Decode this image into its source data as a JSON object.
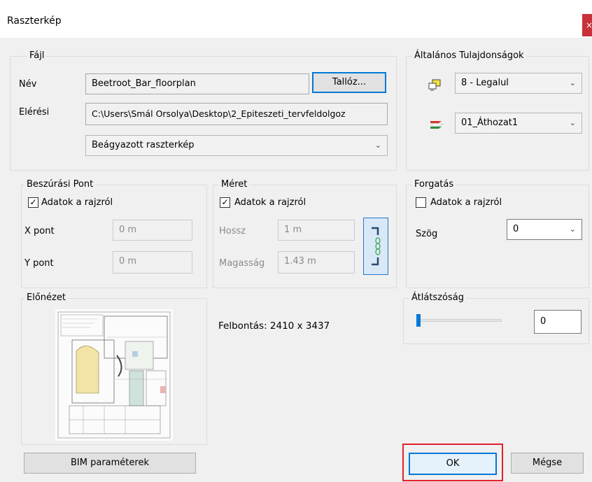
{
  "window": {
    "title": "Raszterkép",
    "close_glyph": "×"
  },
  "file_group": {
    "legend": "Fájl",
    "name_label": "Név",
    "name_value": "Beetroot_Bar_floorplan",
    "browse_label": "Tallóz...",
    "path_label": "Elérési",
    "path_value": "C:\\Users\\Smál Orsolya\\Desktop\\2_Epiteszeti_tervfeldolgoz",
    "embed_value": "Beágyazott raszterkép"
  },
  "general_group": {
    "legend": "Általános Tulajdonságok",
    "layer_value": "8 - Legalul",
    "layer_icon": "layer-order-icon",
    "pattern_value": "01_Áthozat1",
    "pattern_icon": "layer-stack-icon"
  },
  "insert_group": {
    "legend": "Beszúrási Pont",
    "from_drawing_label": "Adatok a rajzról",
    "from_drawing_checked": true,
    "x_label": "X pont",
    "x_value": "0 m",
    "y_label": "Y pont",
    "y_value": "0 m"
  },
  "size_group": {
    "legend": "Méret",
    "from_drawing_label": "Adatok a rajzról",
    "from_drawing_checked": true,
    "length_label": "Hossz",
    "length_value": "1 m",
    "height_label": "Magasság",
    "height_value": "1.43 m",
    "link_icon": "chain-link-icon"
  },
  "rotation_group": {
    "legend": "Forgatás",
    "from_drawing_label": "Adatok a rajzról",
    "from_drawing_checked": false,
    "angle_label": "Szög",
    "angle_value": "0"
  },
  "preview_group": {
    "legend": "Előnézet"
  },
  "resolution_text": "Felbontás: 2410 x 3437",
  "transparency_group": {
    "legend": "Átlátszóság",
    "value": "0",
    "slider_level": 0
  },
  "buttons": {
    "bim": "BIM paraméterek",
    "ok": "OK",
    "cancel": "Mégse"
  },
  "colors": {
    "ok_highlight": "#e0202a",
    "focus_border": "#0078d7",
    "close_bg": "#c8303a"
  }
}
